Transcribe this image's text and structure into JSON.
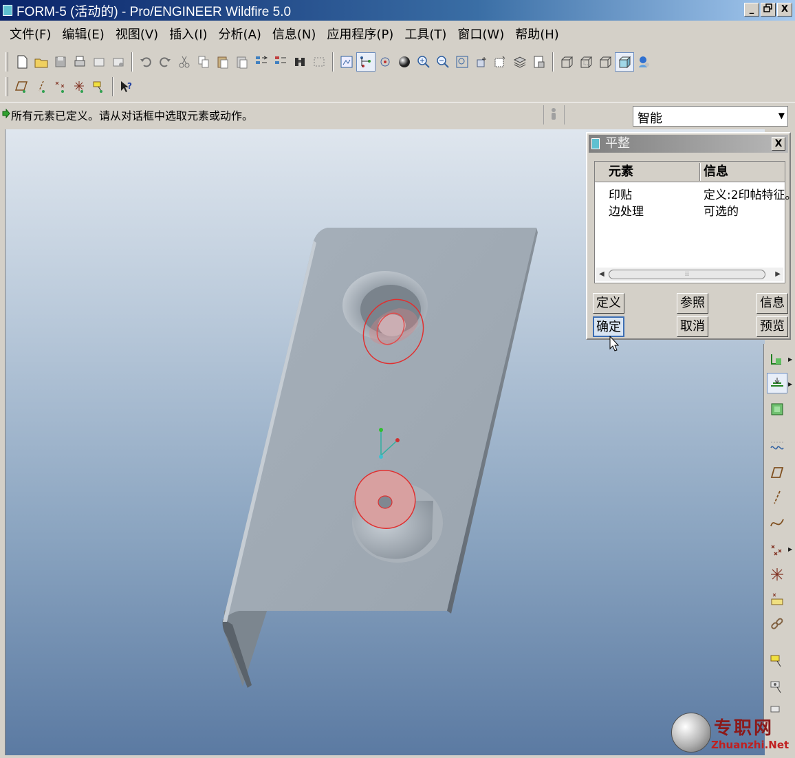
{
  "window": {
    "title": "FORM-5 (活动的) - Pro/ENGINEER Wildfire 5.0",
    "minimize": "_",
    "maximize": "🗗",
    "close": "X"
  },
  "menu": [
    {
      "label": "文件(F)"
    },
    {
      "label": "编辑(E)"
    },
    {
      "label": "视图(V)"
    },
    {
      "label": "插入(I)"
    },
    {
      "label": "分析(A)"
    },
    {
      "label": "信息(N)"
    },
    {
      "label": "应用程序(P)"
    },
    {
      "label": "工具(T)"
    },
    {
      "label": "窗口(W)"
    },
    {
      "label": "帮助(H)"
    }
  ],
  "message": {
    "text": "所有元素已定义。请从对话框中选取元素或动作。"
  },
  "filter": {
    "value": "智能"
  },
  "dialog": {
    "title": "平整",
    "columns": {
      "element": "元素",
      "info": "信息"
    },
    "rows": [
      {
        "element": "印贴",
        "info": "定义:2印帖特征。"
      },
      {
        "element": "边处理",
        "info": "可选的"
      }
    ],
    "scroll_grip": "⦙⦙⦙",
    "buttons": {
      "define": "定义",
      "refs": "参照",
      "info": "信息",
      "ok": "确定",
      "cancel": "取消",
      "preview": "预览"
    }
  },
  "watermark": {
    "cn": "专职网",
    "en": "Zhuanzhi.Net"
  },
  "colors": {
    "title_bar": "#0a246a",
    "part_face": "#a9b3bd",
    "highlight": "#e03030",
    "graphics_top": "#dfe6ee",
    "graphics_bottom": "#5b7aa2"
  }
}
